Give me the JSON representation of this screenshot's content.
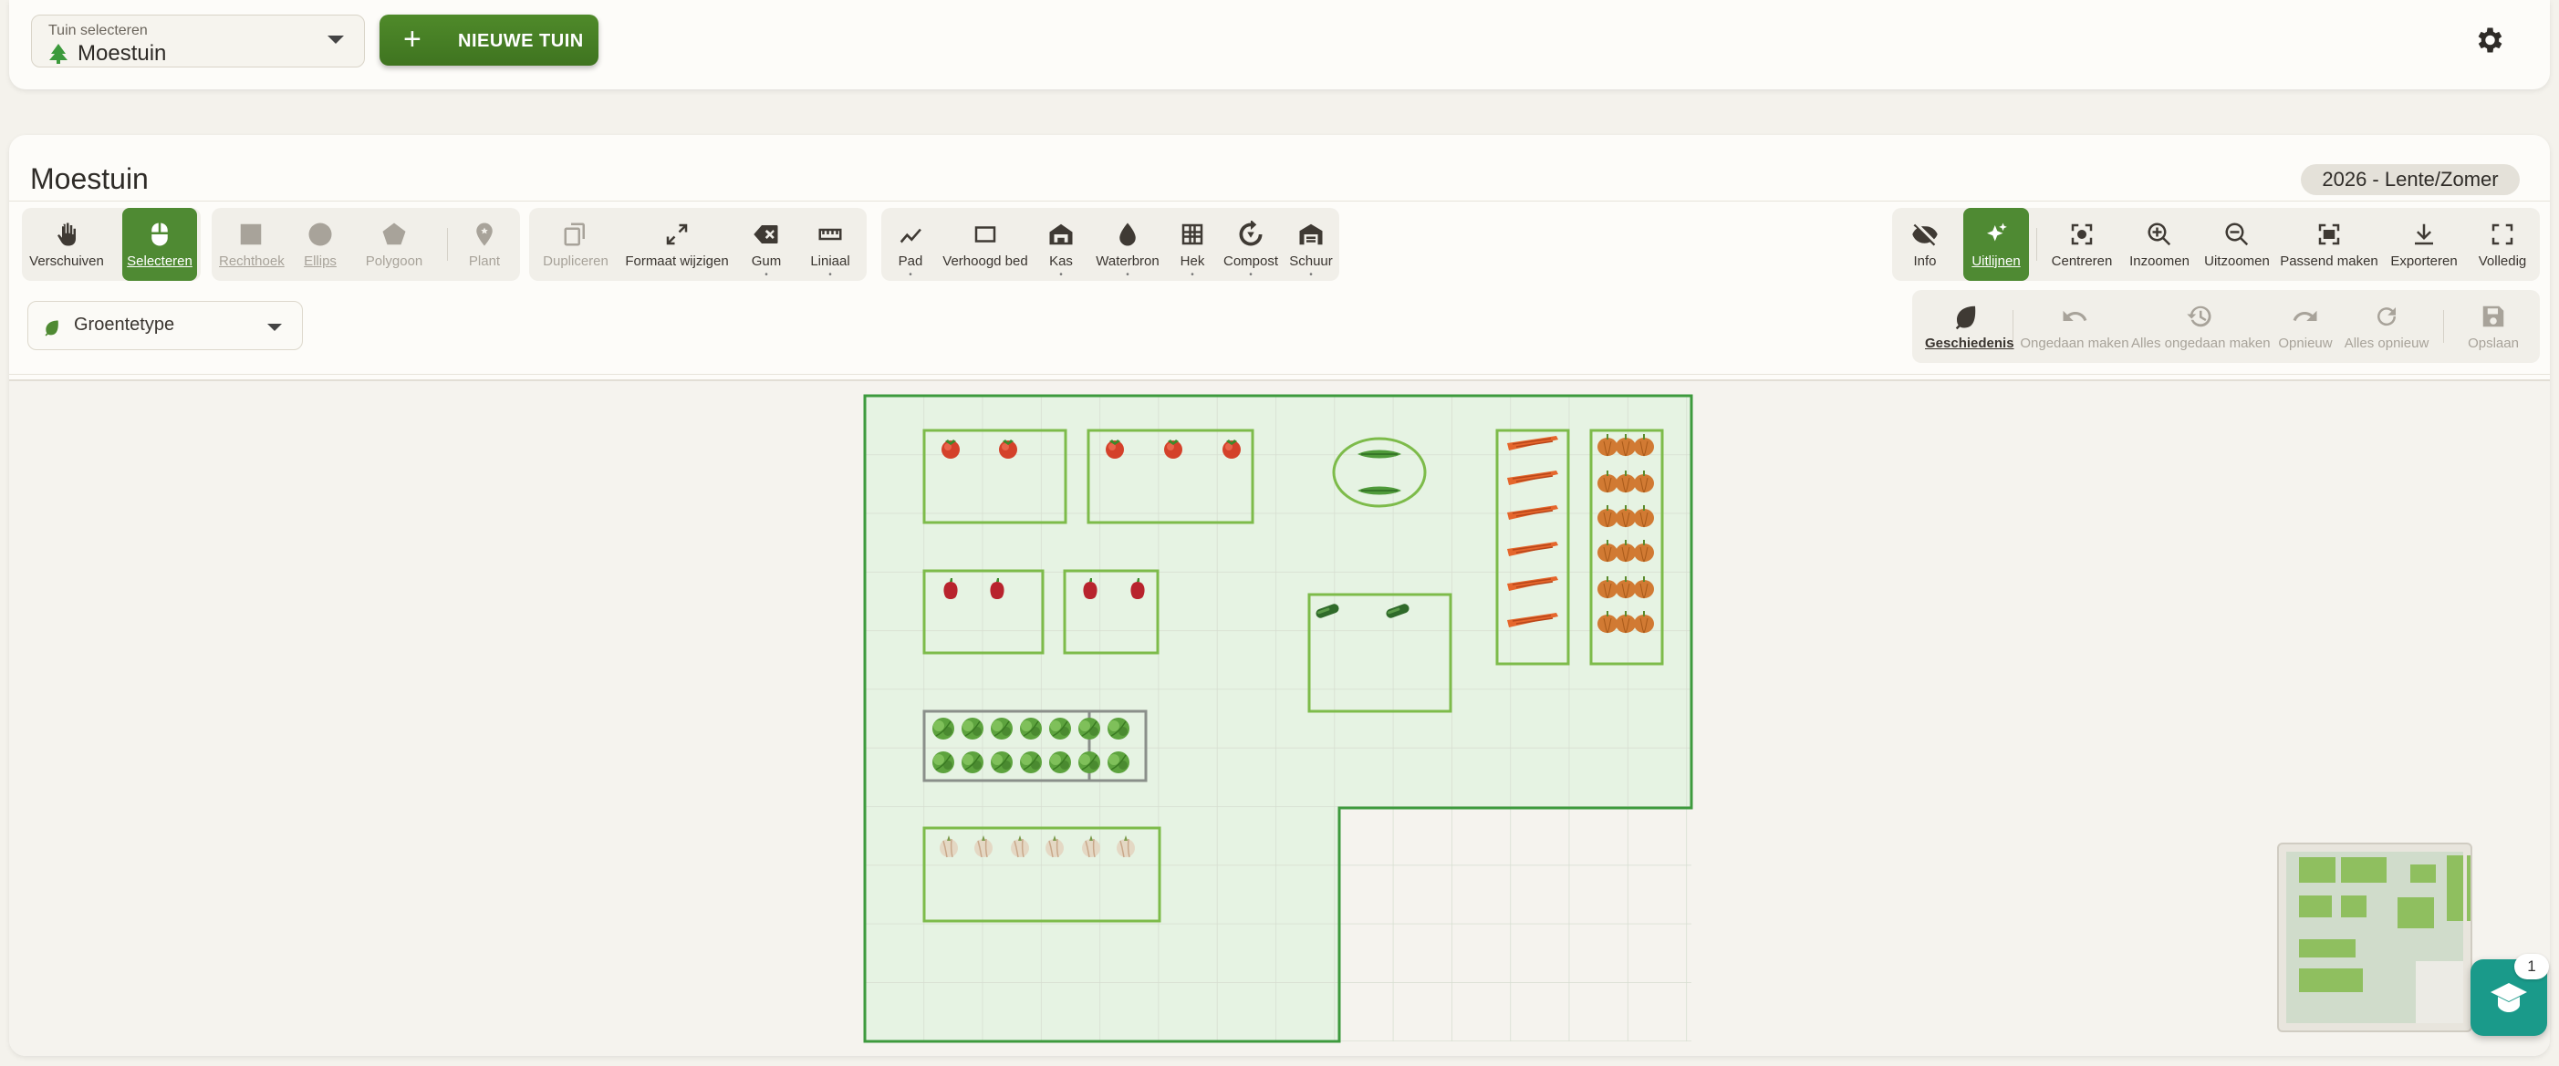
{
  "topbar": {
    "garden_select_label": "Tuin selecteren",
    "garden_select_value": "Moestuin",
    "new_garden_label": "NIEUWE TUIN"
  },
  "main": {
    "title": "Moestuin",
    "season": "2026 - Lente/Zomer"
  },
  "toolbar": {
    "nav": [
      "Verschuiven",
      "Selecteren"
    ],
    "shapes": [
      "Rechthoek",
      "Ellips",
      "Polygoon",
      "Plant"
    ],
    "edit": [
      "Dupliceren",
      "Formaat wijzigen",
      "Gum",
      "Liniaal"
    ],
    "objects": [
      "Pad",
      "Verhoogd bed",
      "Kas",
      "Waterbron",
      "Hek",
      "Compost",
      "Schuur"
    ],
    "view": [
      "Info",
      "Uitlijnen",
      "Centreren",
      "Inzoomen",
      "Uitzoomen",
      "Passend maken",
      "Exporteren",
      "Volledig"
    ],
    "history": [
      "Geschiedenis",
      "Ongedaan maken",
      "Alles ongedaan maken",
      "Opnieuw",
      "Alles opnieuw",
      "Opslaan"
    ]
  },
  "filter": {
    "veg_type_label": "Groentetype"
  },
  "help": {
    "badge_count": "1"
  },
  "colors": {
    "accent": "#4f8a33",
    "garden_fill": "#e6f3e3",
    "garden_border": "#3d9a3d",
    "bed_border": "#7dbb4a",
    "fab": "#1a9a8a"
  },
  "plants": {
    "tomato": "tomato-icon",
    "pepper": "red-pepper-icon",
    "bean": "green-bean-icon",
    "zucchini": "zucchini-icon",
    "carrot": "carrot-icon",
    "onion": "onion-icon",
    "lettuce": "lettuce-icon",
    "garlic": "garlic-icon"
  }
}
